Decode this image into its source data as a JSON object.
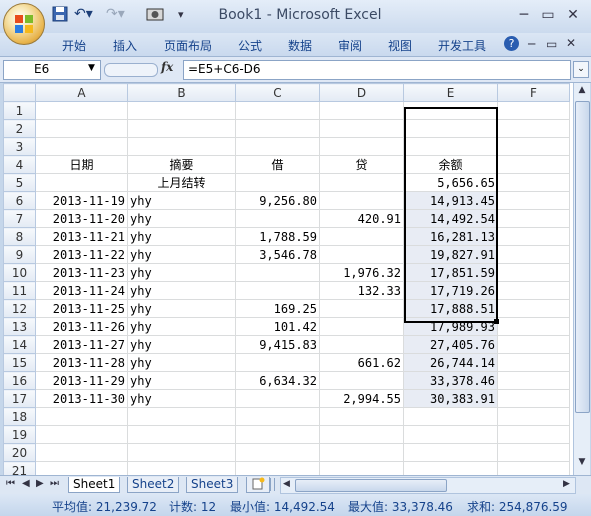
{
  "app": {
    "title": "Book1 - Microsoft Excel"
  },
  "ribbon_tabs": [
    "开始",
    "插入",
    "页面布局",
    "公式",
    "数据",
    "审阅",
    "视图",
    "开发工具"
  ],
  "formula_bar": {
    "name_box": "E6",
    "fx_label": "fx",
    "formula": "=E5+C6-D6"
  },
  "columns": [
    "A",
    "B",
    "C",
    "D",
    "E",
    "F"
  ],
  "rows": [
    {
      "n": "1",
      "a": "",
      "b": "",
      "c": "",
      "d": "",
      "e": ""
    },
    {
      "n": "2",
      "a": "",
      "b": "",
      "c": "",
      "d": "",
      "e": ""
    },
    {
      "n": "3",
      "a": "",
      "b": "",
      "c": "",
      "d": "",
      "e": ""
    },
    {
      "n": "4",
      "a": "日期",
      "b": "摘要",
      "c": "借",
      "d": "贷",
      "e": "余额"
    },
    {
      "n": "5",
      "a": "",
      "b": "上月结转",
      "c": "",
      "d": "",
      "e": "5,656.65"
    },
    {
      "n": "6",
      "a": "2013-11-19",
      "b": "yhy",
      "c": "9,256.80",
      "d": "",
      "e": "14,913.45"
    },
    {
      "n": "7",
      "a": "2013-11-20",
      "b": "yhy",
      "c": "",
      "d": "420.91",
      "e": "14,492.54"
    },
    {
      "n": "8",
      "a": "2013-11-21",
      "b": "yhy",
      "c": "1,788.59",
      "d": "",
      "e": "16,281.13"
    },
    {
      "n": "9",
      "a": "2013-11-22",
      "b": "yhy",
      "c": "3,546.78",
      "d": "",
      "e": "19,827.91"
    },
    {
      "n": "10",
      "a": "2013-11-23",
      "b": "yhy",
      "c": "",
      "d": "1,976.32",
      "e": "17,851.59"
    },
    {
      "n": "11",
      "a": "2013-11-24",
      "b": "yhy",
      "c": "",
      "d": "132.33",
      "e": "17,719.26"
    },
    {
      "n": "12",
      "a": "2013-11-25",
      "b": "yhy",
      "c": "169.25",
      "d": "",
      "e": "17,888.51"
    },
    {
      "n": "13",
      "a": "2013-11-26",
      "b": "yhy",
      "c": "101.42",
      "d": "",
      "e": "17,989.93"
    },
    {
      "n": "14",
      "a": "2013-11-27",
      "b": "yhy",
      "c": "9,415.83",
      "d": "",
      "e": "27,405.76"
    },
    {
      "n": "15",
      "a": "2013-11-28",
      "b": "yhy",
      "c": "",
      "d": "661.62",
      "e": "26,744.14"
    },
    {
      "n": "16",
      "a": "2013-11-29",
      "b": "yhy",
      "c": "6,634.32",
      "d": "",
      "e": "33,378.46"
    },
    {
      "n": "17",
      "a": "2013-11-30",
      "b": "yhy",
      "c": "",
      "d": "2,994.55",
      "e": "30,383.91"
    },
    {
      "n": "18",
      "a": "",
      "b": "",
      "c": "",
      "d": "",
      "e": ""
    },
    {
      "n": "19",
      "a": "",
      "b": "",
      "c": "",
      "d": "",
      "e": ""
    },
    {
      "n": "20",
      "a": "",
      "b": "",
      "c": "",
      "d": "",
      "e": ""
    },
    {
      "n": "21",
      "a": "",
      "b": "",
      "c": "",
      "d": "",
      "e": ""
    }
  ],
  "sheets": [
    "Sheet1",
    "Sheet2",
    "Sheet3"
  ],
  "status": {
    "average": "平均值: 21,239.72",
    "count": "计数: 12",
    "min": "最小值: 14,492.54",
    "max": "最大值: 33,378.46",
    "sum": "求和: 254,876.59"
  },
  "colors": {
    "selection_border": "#000000",
    "row_header_selected": "#f5c060",
    "accent": "#15428b"
  }
}
